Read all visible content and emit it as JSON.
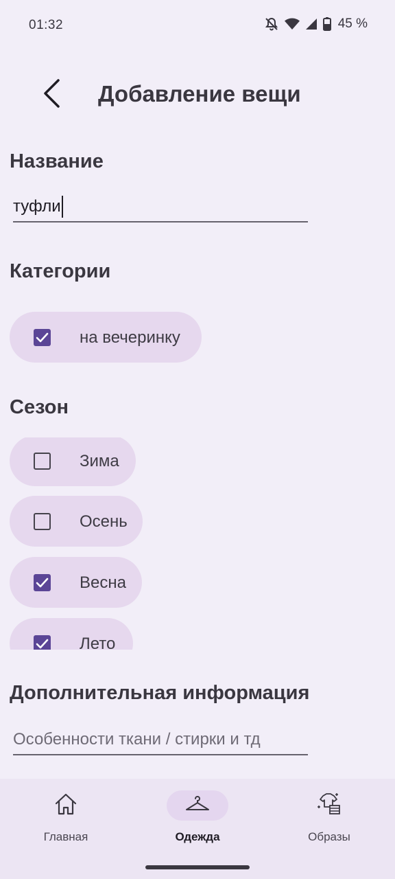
{
  "status_bar": {
    "time": "01:32",
    "battery": "45 %",
    "icons": [
      "mute-icon",
      "wifi-icon",
      "signal-icon",
      "battery-icon"
    ]
  },
  "header": {
    "title": "Добавление вещи",
    "back_icon": "back-arrow-icon"
  },
  "name_section": {
    "heading": "Название",
    "value": "туфли"
  },
  "categories_section": {
    "heading": "Категории",
    "items": [
      {
        "label": "на вечеринку",
        "checked": true
      }
    ]
  },
  "season_section": {
    "heading": "Сезон",
    "items": [
      {
        "label": "Зима",
        "checked": false
      },
      {
        "label": "Осень",
        "checked": false
      },
      {
        "label": "Весна",
        "checked": true
      },
      {
        "label": "Лето",
        "checked": true
      }
    ]
  },
  "info_section": {
    "heading": "Дополнительная информация",
    "placeholder": "Особенности ткани / стирки и тд",
    "value": ""
  },
  "bottom_nav": {
    "items": [
      {
        "label": "Главная",
        "icon": "home-icon",
        "active": false
      },
      {
        "label": "Одежда",
        "icon": "hanger-icon",
        "active": true
      },
      {
        "label": "Образы",
        "icon": "outfits-icon",
        "active": false
      }
    ]
  },
  "colors": {
    "background": "#f2eef8",
    "chip": "#e6d8ee",
    "checkbox_checked": "#5b4596",
    "nav_background": "#ece5f3",
    "text": "#3a3740"
  }
}
